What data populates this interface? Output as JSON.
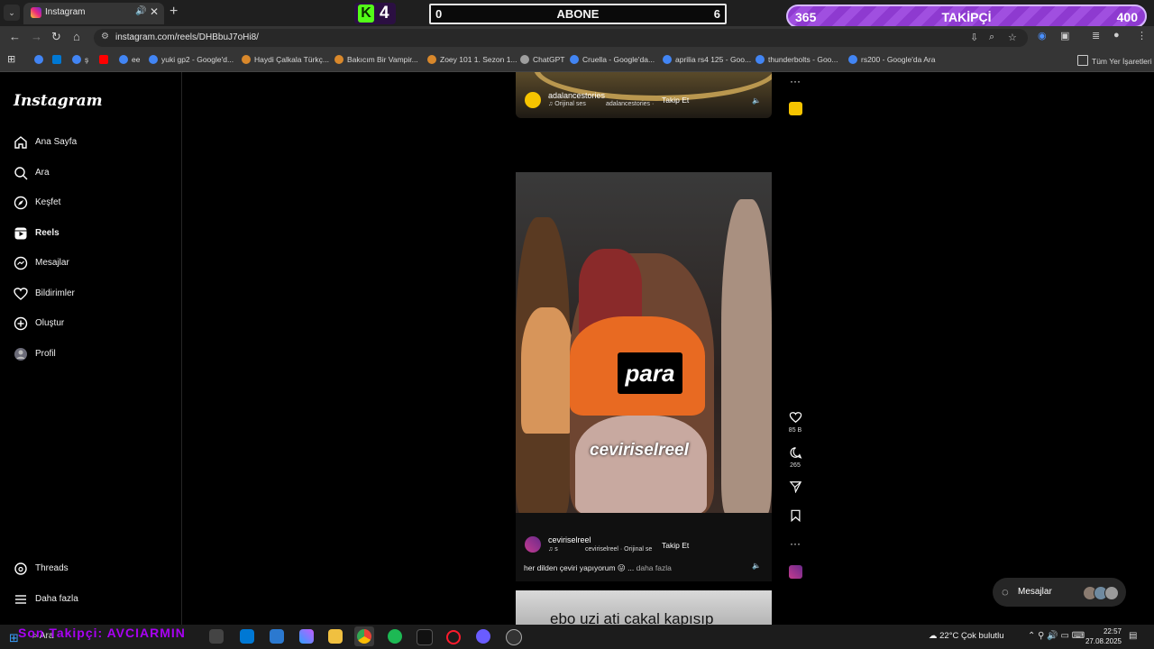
{
  "browser": {
    "tab_title": "Instagram",
    "tab_audio_icon": "speaker-icon",
    "tab_close": "✕",
    "new_tab": "+",
    "url": "instagram.com/reels/DHBbuJ7oHi8/",
    "bookmarks": [
      {
        "label": "ş",
        "color": "#4285f4"
      },
      {
        "label": "ee",
        "color": "#4285f4"
      },
      {
        "label": "yuki gp2 - Google'd...",
        "color": "#4285f4"
      },
      {
        "label": "Haydi Çalkala Türkç...",
        "color": "#d9882b"
      },
      {
        "label": "Bakıcım Bir Vampir...",
        "color": "#d9882b"
      },
      {
        "label": "Zoey 101 1. Sezon 1...",
        "color": "#d9882b"
      },
      {
        "label": "ChatGPT",
        "color": "#9e9e9e"
      },
      {
        "label": "Cruella - Google'da...",
        "color": "#4285f4"
      },
      {
        "label": "aprilia rs4 125 - Goo...",
        "color": "#4285f4"
      },
      {
        "label": "thunderbolts - Goo...",
        "color": "#4285f4"
      },
      {
        "label": "rs200 - Google'da Ara",
        "color": "#4285f4"
      }
    ],
    "all_bookmarks": "Tüm Yer İşaretleri"
  },
  "overlays": {
    "kick_count": "4",
    "abone_left": "0",
    "abone_label": "ABONE",
    "abone_right": "6",
    "takipci_left": "365",
    "takipci_label": "TAKİPÇİ",
    "takipci_right": "400"
  },
  "instagram": {
    "logo": "Instagram",
    "nav": [
      {
        "label": "Ana Sayfa",
        "icon": "home-icon",
        "bold": false
      },
      {
        "label": "Ara",
        "icon": "search-icon",
        "bold": false
      },
      {
        "label": "Keşfet",
        "icon": "compass-icon",
        "bold": false
      },
      {
        "label": "Reels",
        "icon": "reels-icon",
        "bold": true
      },
      {
        "label": "Mesajlar",
        "icon": "messenger-icon",
        "bold": false
      },
      {
        "label": "Bildirimler",
        "icon": "heart-icon",
        "bold": false
      },
      {
        "label": "Oluştur",
        "icon": "plus-icon",
        "bold": false
      },
      {
        "label": "Profil",
        "icon": "avatar-icon",
        "bold": false
      }
    ],
    "nav_bottom": [
      {
        "label": "Threads",
        "icon": "threads-icon"
      },
      {
        "label": "Daha fazla",
        "icon": "menu-icon"
      }
    ],
    "top_reel": {
      "username": "adalancestories",
      "audio": "Orijinal ses",
      "audio_user": "adalancestories ·",
      "follow": "Takip Et"
    },
    "main_reel": {
      "subtitle": "para",
      "watermark": "ceviriselreel",
      "username": "ceviriselreel",
      "audio_prefix": "♫ s",
      "audio": "ceviriselreel · Orijinal se",
      "follow": "Takip Et",
      "caption": "her dilden çeviri yapıyorum 😛 ...",
      "more": "daha fazla"
    },
    "next_reel_text": "ebo uzi ati cakal kapısıp",
    "actions": {
      "likes": "85 B",
      "comments": "265"
    },
    "messages_label": "Mesajlar"
  },
  "taskbar": {
    "search": "Ara",
    "overlay_text": "Son Takipçi: AVCIARMIN",
    "weather": "22°C  Çok bulutlu",
    "time": "22:57",
    "date": "27.08.2025"
  }
}
